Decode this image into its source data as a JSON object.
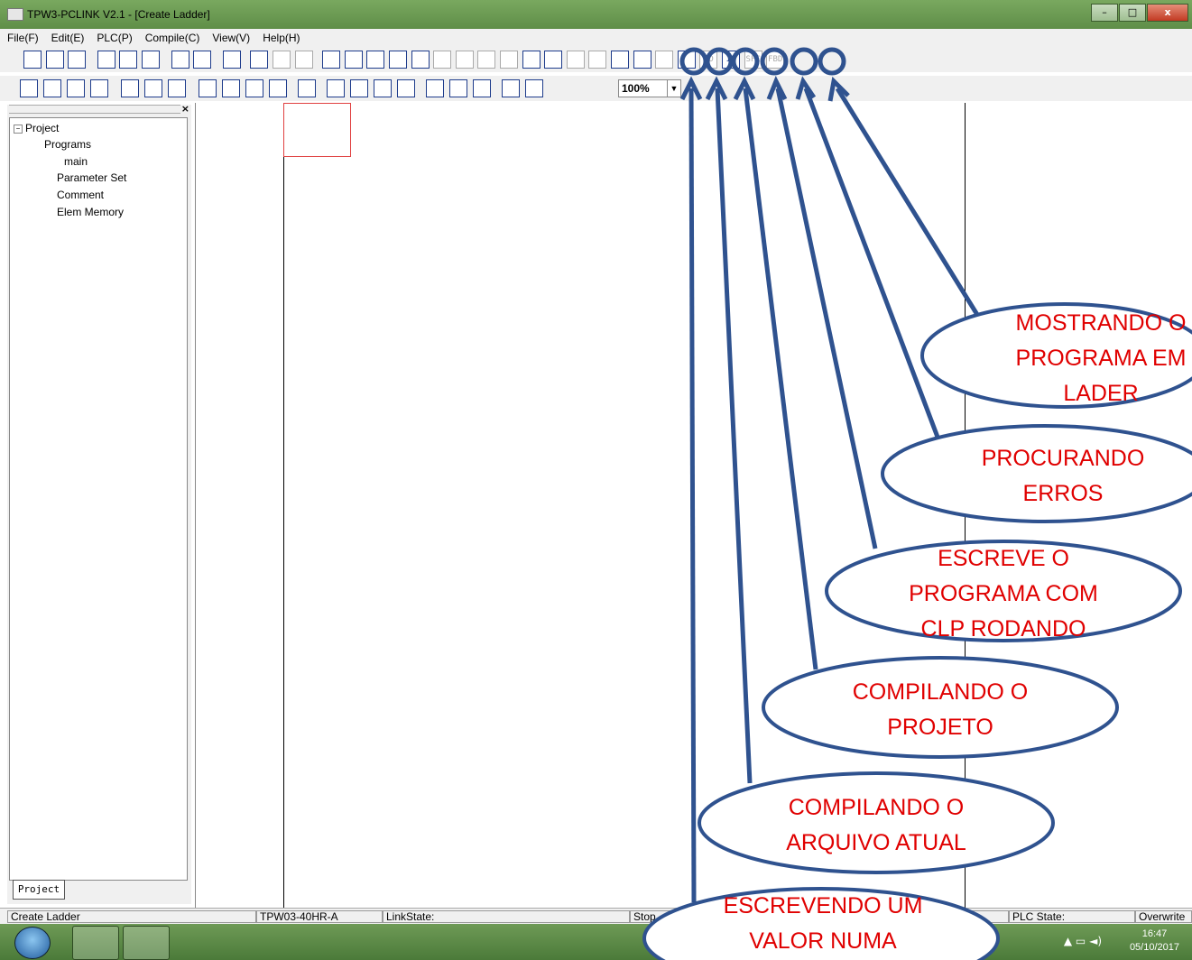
{
  "window": {
    "title": "TPW3-PCLINK V2.1 - [Create Ladder]",
    "minimize": "–",
    "maximize": "□",
    "close": "x"
  },
  "menu": [
    "File(F)",
    "Edit(E)",
    "PLC(P)",
    "Compile(C)",
    "View(V)",
    "Help(H)"
  ],
  "toolbar1": [
    "new-icon",
    "open-icon",
    "save-icon",
    "cut-icon",
    "copy-icon",
    "paste-icon",
    "print-preview-icon",
    "print-icon",
    "help-icon",
    "monitor-icon",
    "undo-icon",
    "redo-icon",
    "find-icon",
    "replace-icon",
    "sort-icon",
    "goto-icon",
    "compare-icon",
    "doc-icon",
    "edit-icon",
    "table-icon",
    "tool-icon",
    "refresh-icon",
    "run-icon",
    "wave-icon",
    "write-value-icon",
    "compile-file-icon",
    "compile-project-icon",
    "online-write-icon",
    "check-errors-icon",
    "LD",
    "IL",
    "SFC",
    "FBD"
  ],
  "toolbar2": [
    "contact-no-icon",
    "contact-nc-icon",
    "contact-p-icon",
    "contact-n-icon",
    "coil-icon",
    "coil-neg-icon",
    "func-icon",
    "hline-icon",
    "hline-neg-icon",
    "vline-icon",
    "vline-del-icon",
    "select-icon",
    "rung-insert-icon",
    "rung-insert2-icon",
    "rung-del-icon",
    "rung-del2-icon",
    "table1-icon",
    "table2-icon",
    "table3-icon",
    "zoom-in-icon",
    "zoom-out-icon"
  ],
  "zoom": "100%",
  "tree": {
    "root": "Project",
    "programs": "Programs",
    "main": "main",
    "parameter_set": "Parameter Set",
    "comment": "Comment",
    "elem_memory": "Elem Memory"
  },
  "panel_tab": "Project",
  "status": {
    "mode": "Create Ladder",
    "model": "TPW03-40HR-A",
    "link": "LinkState:",
    "stop": "Stop",
    "plc_state": "PLC State:",
    "overwrite": "Overwrite"
  },
  "clock": {
    "time": "16:47",
    "date": "05/10/2017"
  },
  "callouts": {
    "ladder": [
      "MOSTRANDO O",
      "PROGRAMA EM",
      "LADER"
    ],
    "errors": [
      "PROCURANDO",
      "ERROS"
    ],
    "online": [
      "ESCREVE O",
      "PROGRAMA COM",
      "CLP RODANDO"
    ],
    "project": [
      "COMPILANDO O",
      "PROJETO"
    ],
    "file": [
      "COMPILANDO O",
      "ARQUIVO ATUAL"
    ],
    "value": [
      "ESCREVENDO UM",
      "VALOR NUMA"
    ]
  },
  "colors": {
    "accent": "#2f528f",
    "callout_text": "#e00000",
    "titlebar": "#6e9a56"
  }
}
